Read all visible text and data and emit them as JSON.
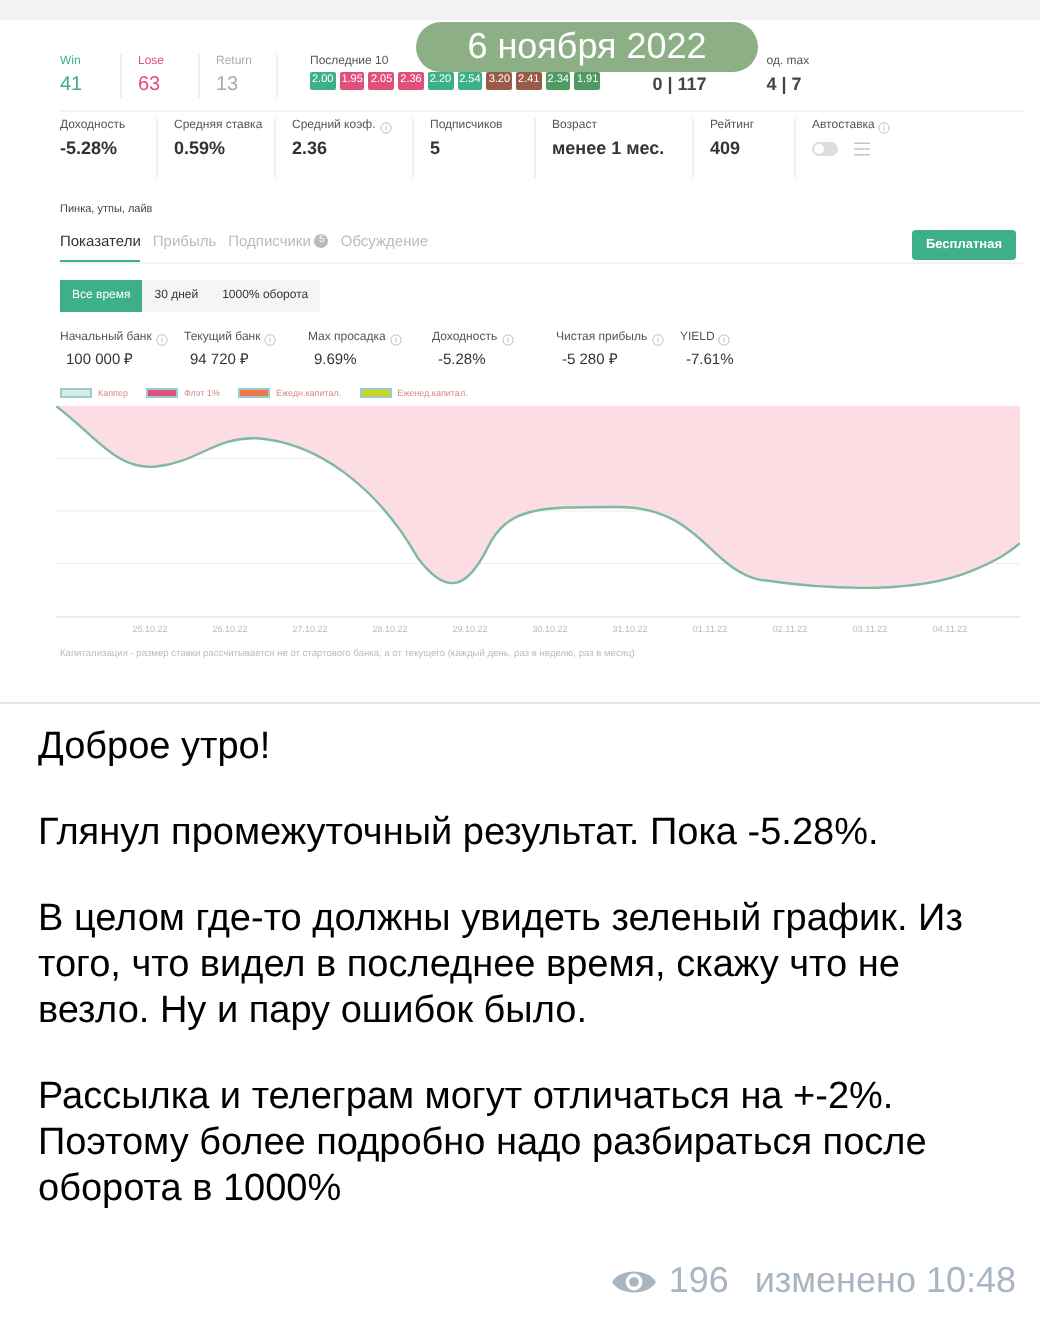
{
  "date_pill": "6 ноября 2022",
  "screenshot": {
    "results": [
      {
        "label": "Win",
        "value": "41",
        "color": "#3db08a"
      },
      {
        "label": "Lose",
        "value": "63",
        "color": "#e0507a"
      },
      {
        "label": "Return",
        "value": "13",
        "color": "#a8acb0"
      }
    ],
    "last10": {
      "label": "Последние 10",
      "badges": [
        {
          "value": "2.00",
          "color": "#3db08a"
        },
        {
          "value": "1.95",
          "color": "#e0507a"
        },
        {
          "value": "2.05",
          "color": "#e0507a"
        },
        {
          "value": "2.36",
          "color": "#e0507a"
        },
        {
          "value": "2.20",
          "color": "#3db08a"
        },
        {
          "value": "2.54",
          "color": "#3db08a"
        },
        {
          "value": "3.20",
          "color": "#9a5a48"
        },
        {
          "value": "2.41",
          "color": "#9a5a48"
        },
        {
          "value": "2.34",
          "color": "#4f9a62"
        },
        {
          "value": "1.91",
          "color": "#4f9a62"
        }
      ]
    },
    "streaks": [
      {
        "value": "0 | 117"
      },
      {
        "label": "од. max",
        "value": "4 | 7"
      }
    ],
    "stats": [
      {
        "label": "Доходность",
        "value": "-5.28%"
      },
      {
        "label": "Средняя ставка",
        "value": "0.59%"
      },
      {
        "label": "Средний коэф.",
        "value": "2.36",
        "info": true
      },
      {
        "label": "Подписчиков",
        "value": "5"
      },
      {
        "label": "Возраст",
        "value": "менее 1 мес."
      },
      {
        "label": "Рейтинг",
        "value": "409"
      }
    ],
    "autostake": {
      "label": "Автоставка",
      "on": false
    },
    "sports": "Пинка, утпы, лайв",
    "tabs": [
      {
        "label": "Показатели",
        "selected": true
      },
      {
        "label": "Прибыль",
        "selected": false
      },
      {
        "label": "Подписчики",
        "selected": false,
        "count": "5"
      },
      {
        "label": "Обсуждение",
        "selected": false
      }
    ],
    "plan_button": "Бесплатная",
    "periods": [
      {
        "label": "Все время",
        "selected": true
      },
      {
        "label": "30 дней",
        "selected": false
      },
      {
        "label": "1000% оборота",
        "selected": false
      }
    ],
    "metrics": [
      {
        "label": "Начальный банк",
        "value": "100 000 ₽"
      },
      {
        "label": "Текущий банк",
        "value": "94 720 ₽"
      },
      {
        "label": "Max просадка",
        "value": "9.69%"
      },
      {
        "label": "Доходность",
        "value": "-5.28%"
      },
      {
        "label": "Чистая прибыль",
        "value": "-5 280 ₽"
      },
      {
        "label": "YIELD",
        "value": "-7.61%"
      }
    ],
    "legend": [
      {
        "label": "Каппер",
        "color": "#d8ece4"
      },
      {
        "label": "Флэт 1%",
        "color": "#e0507a"
      },
      {
        "label": "Ежедн.капитал.",
        "color": "#f07848"
      },
      {
        "label": "Еженед.капитал.",
        "color": "#c8d820"
      }
    ],
    "x_labels": [
      "25.10.22",
      "26.10.22",
      "27.10.22",
      "28.10.22",
      "29.10.22",
      "30.10.22",
      "31.10.22",
      "01.11.22",
      "02.11.22",
      "03.11.22",
      "04.11.22"
    ],
    "footnote": "Капитализация - размер ставки рассчитывается не от стартового банка, а от текущего (каждый день, раз в неделю, раз в месяц)"
  },
  "message": [
    "Доброе утро!",
    "Глянул промежуточный результат. Пока -5.28%.",
    "В целом где-то должны увидеть зеленый график. Из того, что видел в последнее время, скажу что не везло. Ну и пару ошибок было.",
    "Рассылка и телеграм могут отличаться на +-2%. Поэтому более подробно надо разбираться после оборота в 1000%"
  ],
  "views": "196",
  "edited": "изменено 10:48"
}
